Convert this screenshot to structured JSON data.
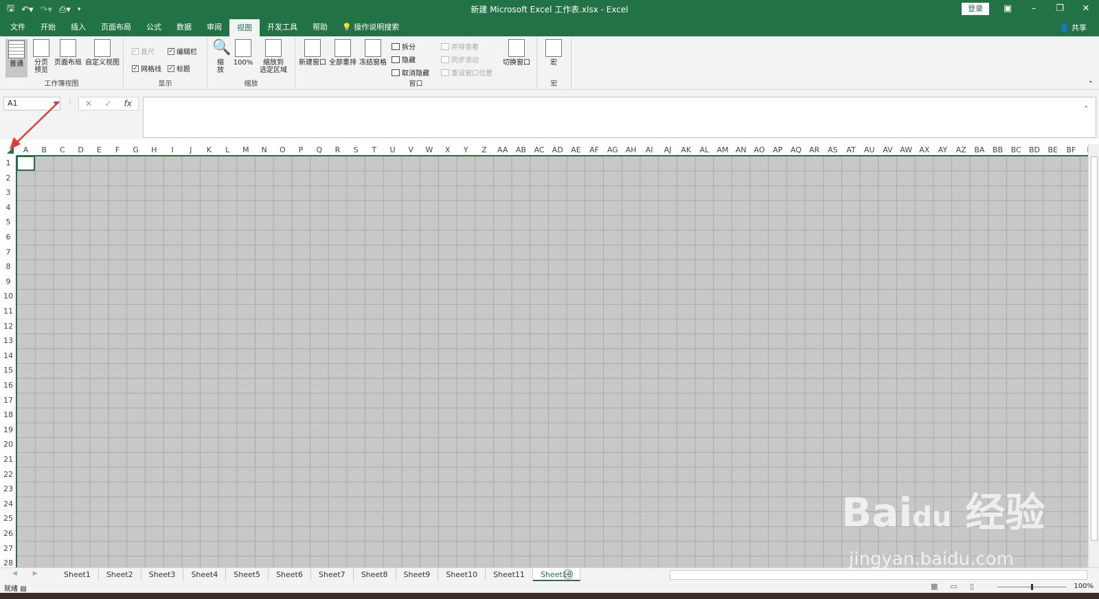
{
  "titlebar": {
    "title": "新建 Microsoft Excel 工作表.xlsx  -  Excel",
    "login": "登录",
    "qat_icons": [
      "save-icon",
      "undo-icon",
      "redo-icon",
      "print-preview-icon",
      "customize-icon"
    ]
  },
  "menu": {
    "tabs": [
      "文件",
      "开始",
      "插入",
      "页面布局",
      "公式",
      "数据",
      "审阅",
      "视图",
      "开发工具",
      "帮助"
    ],
    "active": "视图",
    "tellme": "操作说明搜索",
    "share": "共享"
  },
  "ribbon": {
    "workbook_views": {
      "label": "工作簿视图",
      "normal": "普通",
      "pagebreak": "分页\n预览",
      "layout": "页面布局",
      "custom": "自定义视图"
    },
    "show": {
      "label": "显示",
      "ruler": "直尺",
      "formula_bar": "编辑栏",
      "gridlines": "网格线",
      "headings": "标题"
    },
    "zoom": {
      "label": "缩放",
      "zoom": "缩\n放",
      "zoom100": "100%",
      "zoom_sel": "缩放到\n选定区域"
    },
    "window": {
      "label": "窗口",
      "new_window": "新建窗口",
      "arrange_all": "全部重排",
      "freeze": "冻结窗格",
      "split": "拆分",
      "hide": "隐藏",
      "unhide": "取消隐藏",
      "side_by_side": "并排查看",
      "sync_scroll": "同步滚动",
      "reset_pos": "重设窗口位置",
      "switch": "切换窗口"
    },
    "macros": {
      "label": "宏",
      "macros": "宏"
    }
  },
  "formula": {
    "namebox": "A1",
    "fx": "fx",
    "cancel": "✕",
    "enter": "✓",
    "value": ""
  },
  "columns": [
    "A",
    "B",
    "C",
    "D",
    "E",
    "F",
    "G",
    "H",
    "I",
    "J",
    "K",
    "L",
    "M",
    "N",
    "O",
    "P",
    "Q",
    "R",
    "S",
    "T",
    "U",
    "V",
    "W",
    "X",
    "Y",
    "Z",
    "AA",
    "AB",
    "AC",
    "AD",
    "AE",
    "AF",
    "AG",
    "AH",
    "AI",
    "AJ",
    "AK",
    "AL",
    "AM",
    "AN",
    "AO",
    "AP",
    "AQ",
    "AR",
    "AS",
    "AT",
    "AU",
    "AV",
    "AW",
    "AX",
    "AY",
    "AZ",
    "BA",
    "BB",
    "BC",
    "BD",
    "BE",
    "BF",
    "B"
  ],
  "rows": [
    "1",
    "2",
    "3",
    "4",
    "5",
    "6",
    "7",
    "8",
    "9",
    "10",
    "11",
    "12",
    "13",
    "14",
    "15",
    "16",
    "17",
    "18",
    "19",
    "20",
    "21",
    "22",
    "23",
    "24",
    "25",
    "26",
    "27",
    "28"
  ],
  "sheets": [
    "Sheet1",
    "Sheet2",
    "Sheet3",
    "Sheet4",
    "Sheet5",
    "Sheet6",
    "Sheet7",
    "Sheet8",
    "Sheet9",
    "Sheet10",
    "Sheet11",
    "Sheet13"
  ],
  "active_sheet": "Sheet13",
  "status": {
    "ready": "就绪",
    "zoom": "100%"
  },
  "watermark": {
    "logo": "Bai du 经验",
    "url": "jingyan.baidu.com"
  },
  "colors": {
    "accent": "#217346",
    "annotation_arrow": "#e53935",
    "grid_fill": "#c8c8c8"
  }
}
